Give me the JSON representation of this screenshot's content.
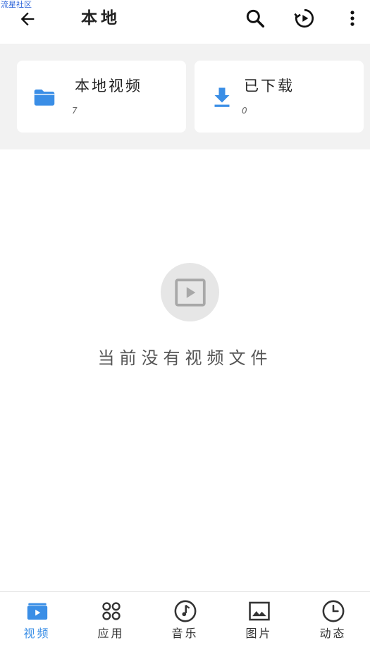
{
  "watermark": "流星社区",
  "header": {
    "title": "本地",
    "icons": [
      "back-arrow-icon",
      "search-icon",
      "history-play-icon",
      "more-vert-icon"
    ]
  },
  "cards": [
    {
      "title": "本地视频",
      "count": "7",
      "icon": "folder-icon"
    },
    {
      "title": "已下载",
      "count": "0",
      "icon": "download-icon"
    }
  ],
  "empty": {
    "message": "当前没有视频文件",
    "icon": "video-play-icon"
  },
  "nav": {
    "items": [
      {
        "label": "视频",
        "icon": "video-icon",
        "active": true
      },
      {
        "label": "应用",
        "icon": "apps-icon",
        "active": false
      },
      {
        "label": "音乐",
        "icon": "music-icon",
        "active": false
      },
      {
        "label": "图片",
        "icon": "image-icon",
        "active": false
      },
      {
        "label": "动态",
        "icon": "clock-icon",
        "active": false
      }
    ]
  },
  "colors": {
    "accent": "#3a8ee6",
    "background_band": "#f2f2f2",
    "text": "#222222"
  }
}
